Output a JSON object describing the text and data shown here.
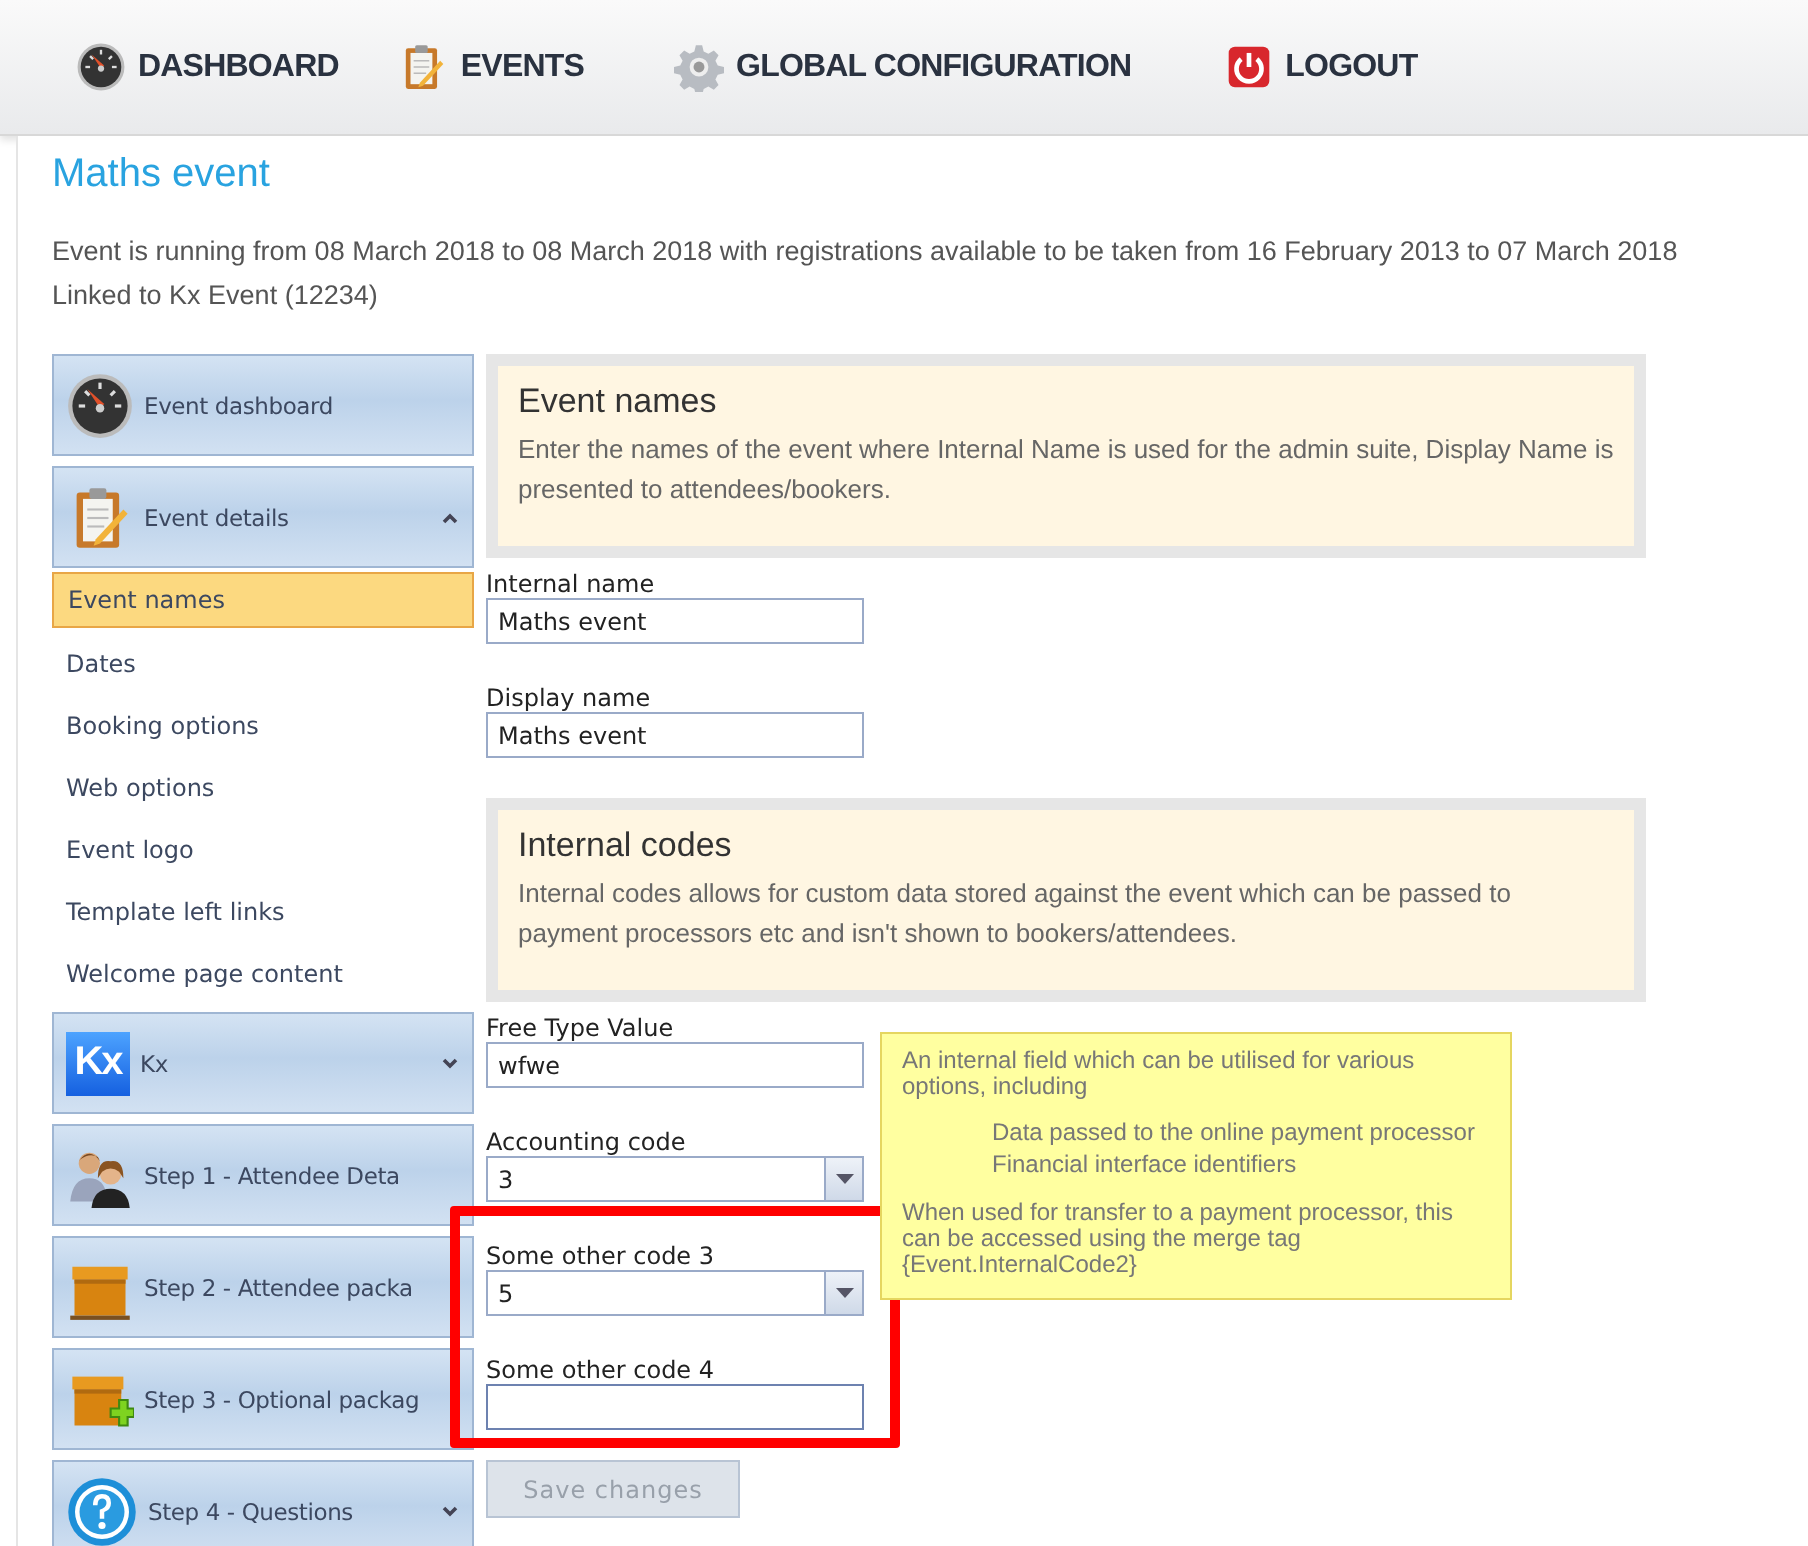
{
  "nav": [
    {
      "label": "DASHBOARD"
    },
    {
      "label": "EVENTS"
    },
    {
      "label": "GLOBAL CONFIGURATION"
    },
    {
      "label": "LOGOUT"
    }
  ],
  "page": {
    "title": "Maths event",
    "summary": [
      "Event is running from 08 March 2018 to 08 March 2018 with registrations available to be taken from 16 February 2013 to 07 March 2018",
      "Linked to Kx Event (12234)"
    ]
  },
  "sidebar": [
    {
      "kind": "link",
      "label": "Event dashboard"
    },
    {
      "kind": "group",
      "label": "Event details",
      "expanded": true,
      "children": [
        {
          "label": "Event names",
          "selected": true
        },
        {
          "label": "Dates",
          "selected": false
        },
        {
          "label": "Booking options",
          "selected": false
        },
        {
          "label": "Web options",
          "selected": false
        },
        {
          "label": "Event logo",
          "selected": false
        },
        {
          "label": "Template left links",
          "selected": false
        },
        {
          "label": "Welcome page content",
          "selected": false
        }
      ]
    },
    {
      "kind": "group",
      "logo_text": "Kx",
      "label": "Kx",
      "expanded": false
    },
    {
      "kind": "link",
      "label": "Step 1 - Attendee Deta"
    },
    {
      "kind": "link",
      "label": "Step 2 - Attendee packa"
    },
    {
      "kind": "link",
      "label": "Step 3 - Optional packag"
    },
    {
      "kind": "group",
      "label": "Step 4 - Questions",
      "expanded": false
    }
  ],
  "sections": [
    {
      "kind": "info",
      "title": "Event names",
      "text": "Enter the names of the event where Internal Name is used for the admin suite, Display Name is presented to attendees/bookers."
    },
    {
      "kind": "text",
      "label": "Internal name",
      "value": "Maths event",
      "highlighted": false
    },
    {
      "kind": "text",
      "label": "Display name",
      "value": "Maths event",
      "highlighted": false
    },
    {
      "kind": "info",
      "title": "Internal codes",
      "text": "Internal codes allows for custom data stored against the event which can be passed to payment processors etc and isn't shown to bookers/attendees."
    },
    {
      "kind": "text",
      "label": "Free Type Value",
      "value": "wfwe",
      "highlighted": false
    },
    {
      "kind": "select",
      "label": "Accounting code",
      "value": "3",
      "highlighted": false
    },
    {
      "kind": "select",
      "label": "Some other code 3",
      "value": "5",
      "highlighted": true
    },
    {
      "kind": "text",
      "label": "Some other code 4",
      "focused": true,
      "highlighted": true
    }
  ],
  "tooltip": {
    "intro": "An internal field which can be utilised for various options, including",
    "items": [
      "Data passed to the online payment processor",
      "Financial interface identifiers"
    ],
    "outro": "When used for transfer to a payment processor, this can be accessed using the merge tag {Event.InternalCode2}"
  },
  "save_button": {
    "label": "Save changes",
    "disabled": true
  }
}
